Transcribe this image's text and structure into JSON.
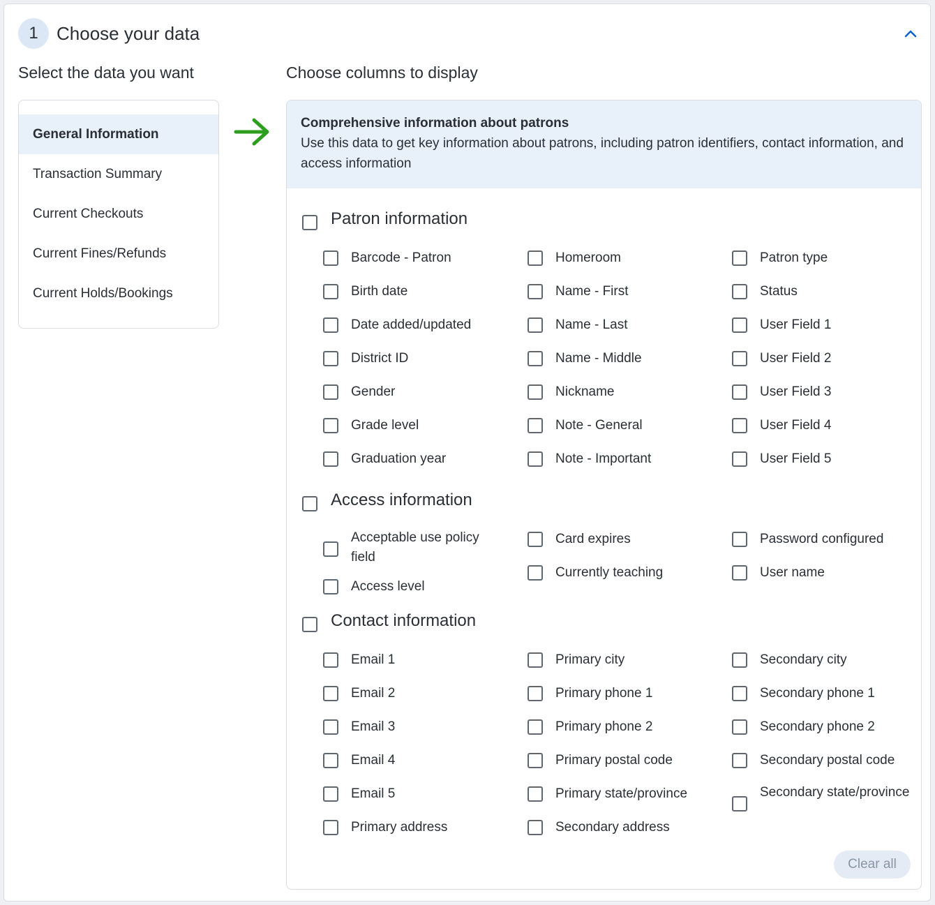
{
  "step": {
    "number": "1",
    "title": "Choose your data"
  },
  "left": {
    "heading": "Select the data you want",
    "items": [
      "General Information",
      "Transaction Summary",
      "Current Checkouts",
      "Current Fines/Refunds",
      "Current Holds/Bookings"
    ],
    "selected_index": 0
  },
  "right": {
    "heading": "Choose columns to display",
    "desc_title": "Comprehensive information about patrons",
    "desc_text": "Use this data to get key information about patrons, including patron identifiers, contact information, and access information",
    "clear_label": "Clear all"
  },
  "groups": [
    {
      "label": "Patron information",
      "columns": [
        [
          "Barcode - Patron",
          "Birth date",
          "Date added/updated",
          "District ID",
          "Gender",
          "Grade level",
          "Graduation year"
        ],
        [
          "Homeroom",
          "Name - First",
          "Name - Last",
          "Name - Middle",
          "Nickname",
          "Note - General",
          "Note - Important"
        ],
        [
          "Patron type",
          "Status",
          "User Field 1",
          "User Field 2",
          "User Field 3",
          "User Field 4",
          "User Field 5"
        ]
      ]
    },
    {
      "label": "Access information",
      "columns": [
        [
          "Acceptable use policy field",
          "Access level"
        ],
        [
          "Card expires",
          "Currently teaching"
        ],
        [
          "Password configured",
          "User name"
        ]
      ]
    },
    {
      "label": "Contact information",
      "columns": [
        [
          "Email 1",
          "Email 2",
          "Email 3",
          "Email 4",
          "Email 5",
          "Primary address"
        ],
        [
          "Primary city",
          "Primary phone 1",
          "Primary phone 2",
          "Primary postal code",
          "Primary state/province",
          "Secondary address"
        ],
        [
          "Secondary city",
          "Secondary phone 1",
          "Secondary phone 2",
          "Secondary postal code",
          "Secondary state/province"
        ]
      ]
    }
  ],
  "colors": {
    "accent": "#0a63c9",
    "arrow": "#2e9e1f",
    "selected_bg": "#e8f0fa"
  },
  "icons": {
    "collapse": "chevron-up-icon",
    "pointer": "arrow-right-icon"
  }
}
